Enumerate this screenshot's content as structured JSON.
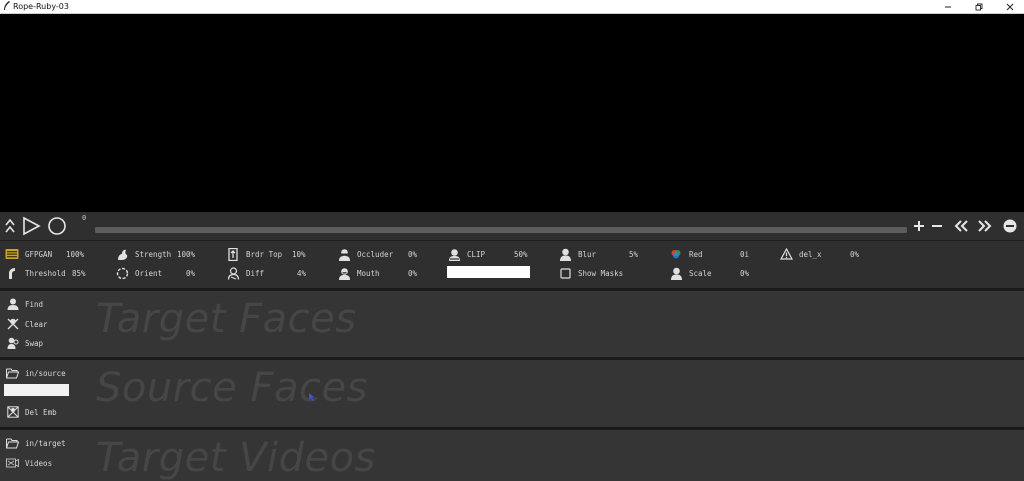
{
  "window": {
    "title": "Rope-Ruby-03"
  },
  "transport": {
    "frame": "0"
  },
  "params": {
    "gfpgan": {
      "label": "GFPGAN",
      "value": "100%"
    },
    "strength": {
      "label": "Strength",
      "value": "100%"
    },
    "brdr_top": {
      "label": "Brdr Top",
      "value": "10%"
    },
    "occluder": {
      "label": "Occluder",
      "value": "0%"
    },
    "clip": {
      "label": "CLIP",
      "value": "50%"
    },
    "blur": {
      "label": "Blur",
      "value": "5%"
    },
    "red": {
      "label": "Red",
      "value": "0i"
    },
    "del_x": {
      "label": "del_x",
      "value": "0%"
    },
    "threshold": {
      "label": "Threshold",
      "value": "85%"
    },
    "orient": {
      "label": "Orient",
      "value": "0%"
    },
    "diff": {
      "label": "Diff",
      "value": "4%"
    },
    "mouth": {
      "label": "Mouth",
      "value": "0%"
    },
    "show_masks": {
      "label": "Show Masks"
    },
    "scale": {
      "label": "Scale",
      "value": "0%"
    }
  },
  "target_faces": {
    "watermark": "Target Faces",
    "find": "Find",
    "clear": "Clear",
    "swap": "Swap"
  },
  "source_faces": {
    "watermark": "Source Faces",
    "folder": "in/source",
    "input_value": "",
    "del_emb": "Del Emb"
  },
  "target_videos": {
    "watermark": "Target Videos",
    "folder": "in/target",
    "videos": "Videos"
  },
  "colors": {
    "background": "#2b2b2b",
    "viewer": "#000000",
    "text": "#d8d8d8",
    "track": "#5c5c5c"
  }
}
